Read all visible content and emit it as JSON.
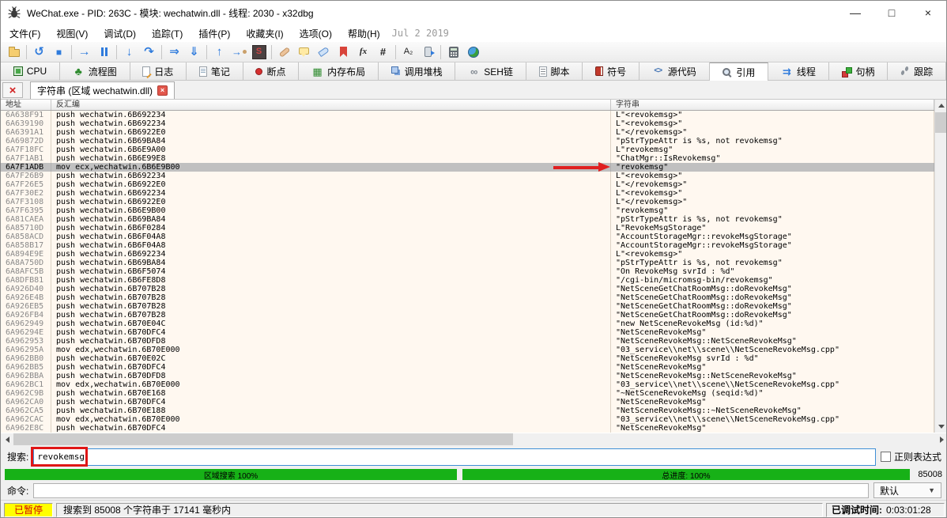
{
  "window": {
    "title": "WeChat.exe - PID: 263C - 模块: wechatwin.dll - 线程: 2030 - x32dbg",
    "controls": {
      "minimize": "—",
      "maximize": "□",
      "close": "×"
    }
  },
  "menu": {
    "items": [
      "文件(F)",
      "视图(V)",
      "调试(D)",
      "追踪(T)",
      "插件(P)",
      "收藏夹(I)",
      "选项(O)",
      "帮助(H)"
    ],
    "date_label": "Jul 2 2019"
  },
  "toolbar": {
    "items": [
      "open-file-icon",
      "sep",
      "restart-icon",
      "stop-icon",
      "sep",
      "run-icon",
      "pause-icon",
      "sep",
      "step-into-icon",
      "step-over-icon",
      "sep",
      "run-to-user-code-icon",
      "execute-till-return-icon",
      "sep",
      "run-until-icon",
      "step-user-icon",
      "scylla-icon",
      "sep",
      "patches-icon",
      "comments-icon",
      "labels-icon",
      "bookmarks-icon",
      "functions-icon",
      "hash-icon",
      "sep",
      "strings-icon",
      "modules-icon",
      "sep",
      "calculator-icon",
      "settings-icon"
    ]
  },
  "tabs": [
    {
      "id": "cpu",
      "label": "CPU",
      "icon": "cpu-icon",
      "active": false
    },
    {
      "id": "graph",
      "label": "流程图",
      "icon": "graph-icon",
      "active": false
    },
    {
      "id": "log",
      "label": "日志",
      "icon": "log-icon",
      "active": false
    },
    {
      "id": "notes",
      "label": "笔记",
      "icon": "notes-icon",
      "active": false
    },
    {
      "id": "breakpoints",
      "label": "断点",
      "icon": "breakpoints-icon",
      "active": false
    },
    {
      "id": "memory-map",
      "label": "内存布局",
      "icon": "memory-map-icon",
      "active": false
    },
    {
      "id": "call-stack",
      "label": "调用堆栈",
      "icon": "call-stack-icon",
      "active": false
    },
    {
      "id": "seh-chain",
      "label": "SEH链",
      "icon": "seh-chain-icon",
      "active": false
    },
    {
      "id": "script",
      "label": "脚本",
      "icon": "script-icon",
      "active": false
    },
    {
      "id": "symbols",
      "label": "符号",
      "icon": "symbols-icon",
      "active": false
    },
    {
      "id": "source",
      "label": "源代码",
      "icon": "source-icon",
      "active": false
    },
    {
      "id": "references",
      "label": "引用",
      "icon": "references-icon",
      "active": true
    },
    {
      "id": "threads",
      "label": "线程",
      "icon": "threads-icon",
      "active": false
    },
    {
      "id": "handles",
      "label": "句柄",
      "icon": "handles-icon",
      "active": false
    },
    {
      "id": "trace",
      "label": "跟踪",
      "icon": "trace-icon",
      "active": false
    }
  ],
  "subtab": {
    "label": "字符串 (区域 wechatwin.dll)",
    "close_icon": "×",
    "close_all_icon": "×"
  },
  "table": {
    "columns": [
      "地址",
      "反汇编",
      "字符串"
    ],
    "selected_index": 6,
    "rows": [
      [
        "6A638F91",
        "push wechatwin.6B692234",
        "L\"<[revokemsg]>\""
      ],
      [
        "6A639190",
        "push wechatwin.6B692234",
        "L\"<[revokemsg]>\""
      ],
      [
        "6A6391A1",
        "push wechatwin.6B6922E0",
        "L\"</[revokemsg]>\""
      ],
      [
        "6A69872D",
        "push wechatwin.6B69BA84",
        "\"pStrTypeAttr is %s, not [revokemsg]\""
      ],
      [
        "6A7F18FC",
        "push wechatwin.6B6E9A00",
        "L\"[revokemsg]\""
      ],
      [
        "6A7F1AB1",
        "push wechatwin.6B6E99E8",
        "\"ChatMgr::Is[Revokemsg]\""
      ],
      [
        "6A7F1ADB",
        "mov ecx,wechatwin.6B6E9B00",
        "\"[revokemsg]\""
      ],
      [
        "6A7F26B9",
        "push wechatwin.6B692234",
        "L\"<[revokemsg]>\""
      ],
      [
        "6A7F26E5",
        "push wechatwin.6B6922E0",
        "L\"</[revokemsg]>\""
      ],
      [
        "6A7F30E2",
        "push wechatwin.6B692234",
        "L\"<[revokemsg]>\""
      ],
      [
        "6A7F3108",
        "push wechatwin.6B6922E0",
        "L\"</[revokemsg]>\""
      ],
      [
        "6A7F6395",
        "push wechatwin.6B6E9B00",
        "\"[revokemsg]\""
      ],
      [
        "6A81CAEA",
        "push wechatwin.6B69BA84",
        "\"pStrTypeAttr is %s, not [revokemsg]\""
      ],
      [
        "6A85710D",
        "push wechatwin.6B6F0284",
        "L\"[RevokeMsg]Storage\""
      ],
      [
        "6A858ACD",
        "push wechatwin.6B6F04A8",
        "\"AccountStorageMgr::[revokeMsg]Storage\""
      ],
      [
        "6A858B17",
        "push wechatwin.6B6F04A8",
        "\"AccountStorageMgr::[revokeMsg]Storage\""
      ],
      [
        "6A894E9E",
        "push wechatwin.6B692234",
        "L\"<[revokemsg]>\""
      ],
      [
        "6A8A750D",
        "push wechatwin.6B69BA84",
        "\"pStrTypeAttr is %s, not [revokemsg]\""
      ],
      [
        "6A8AFC5B",
        "push wechatwin.6B6F5074",
        "\"On [RevokeMsg] svrId : %d\""
      ],
      [
        "6A8DFB81",
        "push wechatwin.6B6FE8D8",
        "\"/cgi-bin/micromsg-bin/[revokemsg]\""
      ],
      [
        "6A926D40",
        "push wechatwin.6B707B28",
        "\"NetSceneGetChatRoomMsg::do[RevokeMsg]\""
      ],
      [
        "6A926E4B",
        "push wechatwin.6B707B28",
        "\"NetSceneGetChatRoomMsg::do[RevokeMsg]\""
      ],
      [
        "6A926EB5",
        "push wechatwin.6B707B28",
        "\"NetSceneGetChatRoomMsg::do[RevokeMsg]\""
      ],
      [
        "6A926FB4",
        "push wechatwin.6B707B28",
        "\"NetSceneGetChatRoomMsg::do[RevokeMsg]\""
      ],
      [
        "6A962949",
        "push wechatwin.6B70E04C",
        "\"new NetScene[RevokeMsg] (id:%d)\""
      ],
      [
        "6A96294E",
        "push wechatwin.6B70DFC4",
        "\"NetScene[RevokeMsg]\""
      ],
      [
        "6A962953",
        "push wechatwin.6B70DFD8",
        "\"NetScene[RevokeMsg]::NetScene[RevokeMsg]\""
      ],
      [
        "6A96295A",
        "mov edx,wechatwin.6B70E000",
        "\"03_service\\\\net\\\\scene\\\\NetScene[RevokeMsg].cpp\""
      ],
      [
        "6A962BB0",
        "push wechatwin.6B70E02C",
        "\"NetScene[RevokeMsg] svrId : %d\""
      ],
      [
        "6A962BB5",
        "push wechatwin.6B70DFC4",
        "\"NetScene[RevokeMsg]\""
      ],
      [
        "6A962BBA",
        "push wechatwin.6B70DFD8",
        "\"NetScene[RevokeMsg]::NetScene[RevokeMsg]\""
      ],
      [
        "6A962BC1",
        "mov edx,wechatwin.6B70E000",
        "\"03_service\\\\net\\\\scene\\\\NetScene[RevokeMsg].cpp\""
      ],
      [
        "6A962C9B",
        "push wechatwin.6B70E168",
        "\"~NetScene[RevokeMsg] (seqid:%d)\""
      ],
      [
        "6A962CA0",
        "push wechatwin.6B70DFC4",
        "\"NetScene[RevokeMsg]\""
      ],
      [
        "6A962CA5",
        "push wechatwin.6B70E188",
        "\"NetScene[RevokeMsg]::~NetScene[RevokeMsg]\""
      ],
      [
        "6A962CAC",
        "mov edx,wechatwin.6B70E000",
        "\"03_service\\\\net\\\\scene\\\\NetScene[RevokeMsg].cpp\""
      ],
      [
        "6A962E8C",
        "push wechatwin.6B70DFC4",
        "\"NetSceneRevokeMsg\""
      ]
    ]
  },
  "search": {
    "label": "搜索:",
    "value": "revokemsg",
    "regex_label": "正则表达式"
  },
  "progress": {
    "left_label": "区域搜索 100%",
    "right_label": "总进度: 100%",
    "count": "85008"
  },
  "command": {
    "label": "命令:",
    "value": "",
    "profile": "默认"
  },
  "status": {
    "state": "已暂停",
    "message": "搜索到 85008 个字符串于 17141 毫秒内",
    "time_label": "已调试时间:",
    "time_value": "0:03:01:28"
  },
  "colors": {
    "selection": "#c0c0c0",
    "highlight_underline": "#e00000",
    "progress_green": "#17b117",
    "paused_bg": "#ffff00",
    "paused_text": "#d00000",
    "annotation_red": "#e01616"
  }
}
